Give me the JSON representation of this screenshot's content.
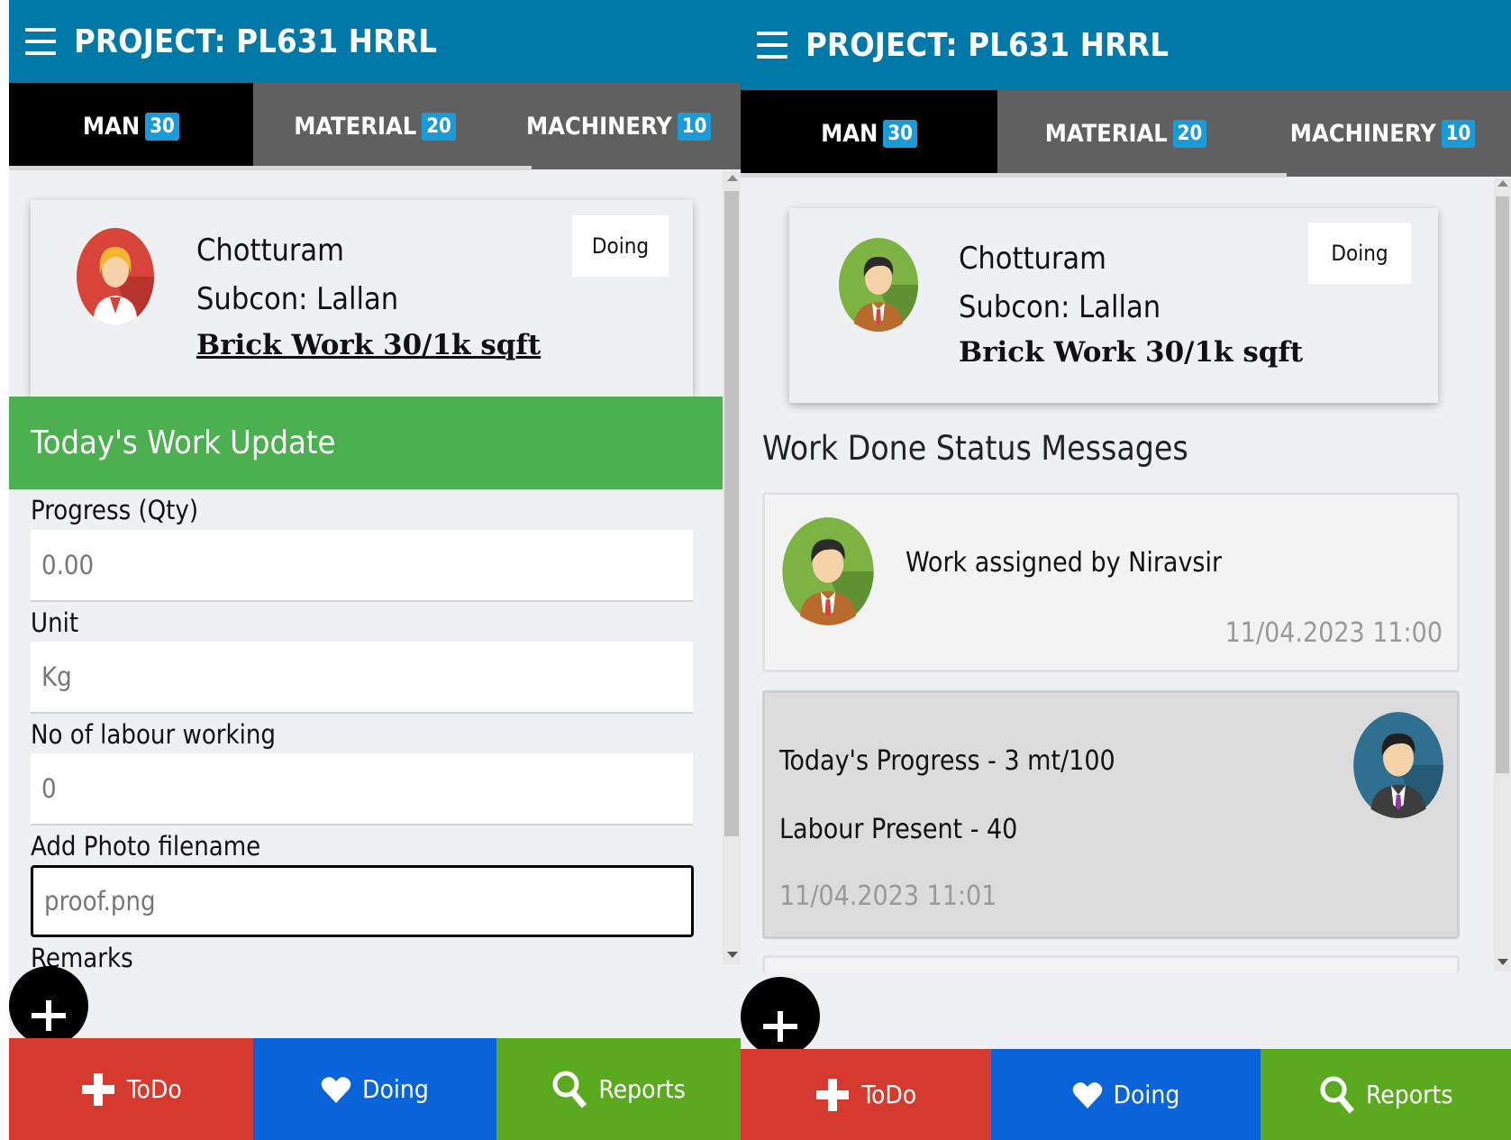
{
  "left": {
    "header": {
      "title": "PROJECT: PL631 HRRL"
    },
    "tabs": [
      {
        "label": "MAN",
        "count": "30",
        "active": true
      },
      {
        "label": "MATERIAL",
        "count": "20",
        "active": false
      },
      {
        "label": "MACHINERY",
        "count": "10",
        "active": false
      }
    ],
    "card": {
      "name": "Chotturam",
      "subcon": "Subcon: Lallan",
      "work": "Brick Work 30/1k sqft",
      "status": "Doing"
    },
    "section_title": "Today's Work Update",
    "fields": [
      {
        "label": "Progress (Qty)",
        "value": "0.00"
      },
      {
        "label": "Unit",
        "value": "Kg"
      },
      {
        "label": "No of labour working",
        "value": "0"
      },
      {
        "label": "Add Photo filename",
        "value": "proof.png"
      },
      {
        "label": "Remarks"
      }
    ]
  },
  "right": {
    "header": {
      "title": "PROJECT: PL631 HRRL"
    },
    "tabs": [
      {
        "label": "MAN",
        "count": "30",
        "active": true
      },
      {
        "label": "MATERIAL",
        "count": "20",
        "active": false
      },
      {
        "label": "MACHINERY",
        "count": "10",
        "active": false
      }
    ],
    "card": {
      "name": "Chotturam",
      "subcon": "Subcon: Lallan",
      "work": "Brick Work 30/1k sqft",
      "status": "Doing"
    },
    "section_title": "Work Done Status Messages",
    "messages": [
      {
        "text": "Work assigned by Niravsir",
        "time": "11/04.2023 11:00"
      },
      {
        "line1": "Today's Progress - 3 mt/100",
        "line2": "Labour Present - 40",
        "time": "11/04.2023 11:01"
      }
    ]
  },
  "bottom_nav": [
    {
      "label": "ToDo",
      "icon": "plus-icon"
    },
    {
      "label": "Doing",
      "icon": "heart-icon"
    },
    {
      "label": "Reports",
      "icon": "search-icon"
    }
  ],
  "colors": {
    "header": "#0078a8",
    "tab_active": "#000000",
    "tab_inactive": "#606060",
    "badge": "#1a9ad6",
    "green_bar": "#4caf50",
    "todo": "#d63a2f",
    "doing": "#0a63d8",
    "reports": "#5aa91e"
  }
}
